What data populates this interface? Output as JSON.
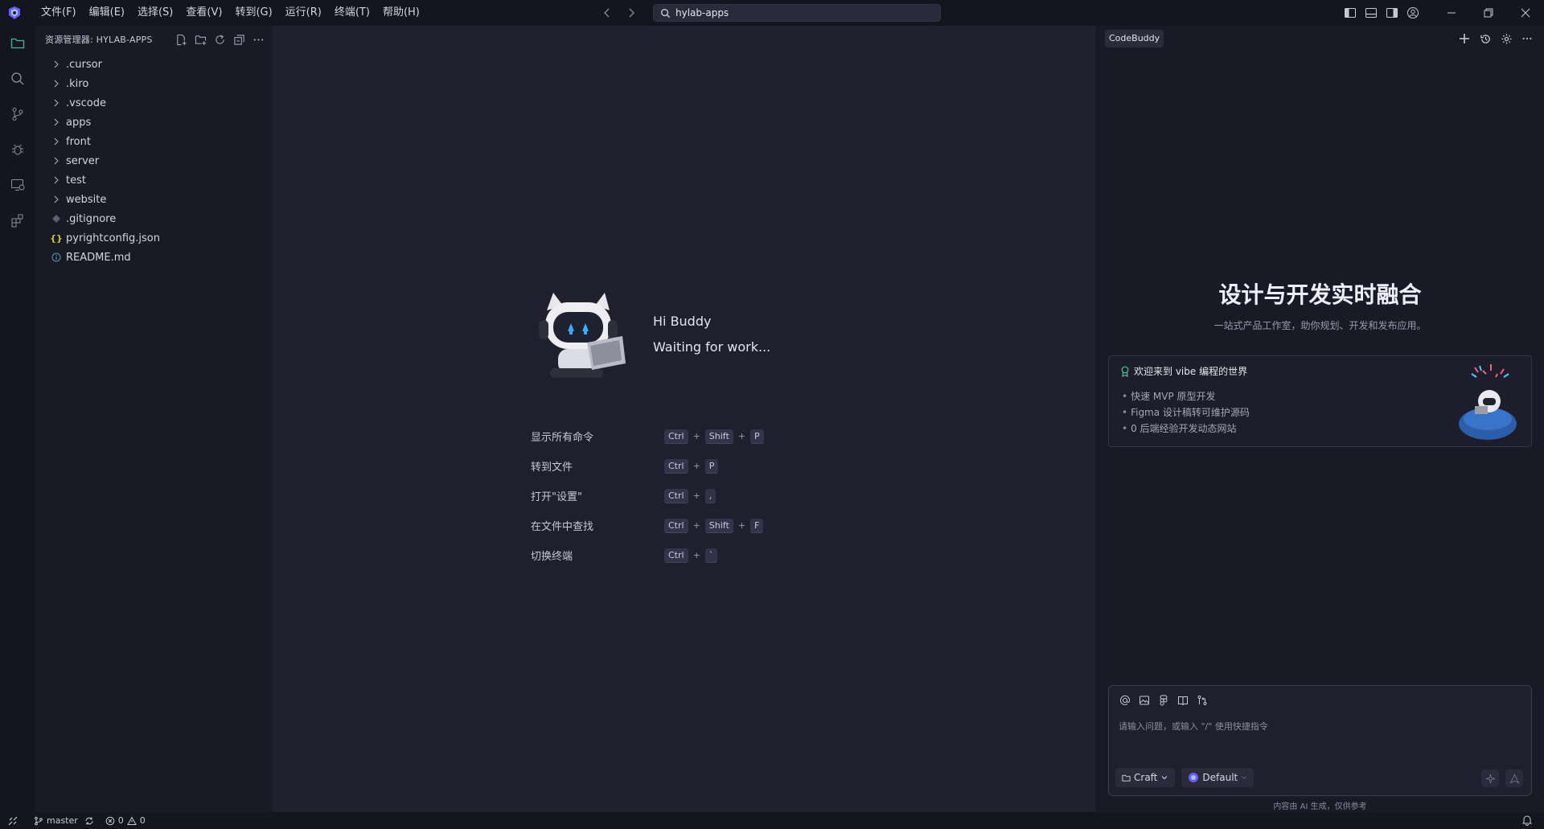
{
  "titlebar": {
    "menus": [
      "文件(F)",
      "编辑(E)",
      "选择(S)",
      "查看(V)",
      "转到(G)",
      "运行(R)",
      "终端(T)",
      "帮助(H)"
    ],
    "search_text": "hylab-apps"
  },
  "sidebar": {
    "title": "资源管理器: HYLAB-APPS",
    "folders": [
      ".cursor",
      ".kiro",
      ".vscode",
      "apps",
      "front",
      "server",
      "test",
      "website"
    ],
    "files": [
      {
        "name": ".gitignore",
        "icon": "git-file-icon"
      },
      {
        "name": "pyrightconfig.json",
        "icon": "json-file-icon"
      },
      {
        "name": "README.md",
        "icon": "info-file-icon"
      }
    ]
  },
  "welcome": {
    "greeting": "Hi Buddy",
    "status": "Waiting for work...",
    "shortcuts": [
      {
        "label": "显示所有命令",
        "keys": [
          "Ctrl",
          "Shift",
          "P"
        ]
      },
      {
        "label": "转到文件",
        "keys": [
          "Ctrl",
          "P"
        ]
      },
      {
        "label": "打开\"设置\"",
        "keys": [
          "Ctrl",
          ","
        ]
      },
      {
        "label": "在文件中查找",
        "keys": [
          "Ctrl",
          "Shift",
          "F"
        ]
      },
      {
        "label": "切换终端",
        "keys": [
          "Ctrl",
          "`"
        ]
      }
    ]
  },
  "panel": {
    "tab": "CodeBuddy",
    "hero_title": "设计与开发实时融合",
    "hero_subtitle": "一站式产品工作室，助你规划、开发和发布应用。",
    "card": {
      "title": "欢迎来到 vibe 编程的世界",
      "items": [
        "快速 MVP 原型开发",
        "Figma 设计稿转可维护源码",
        "0 后端经验开发动态网站"
      ]
    },
    "chat": {
      "placeholder": "请输入问题，或输入 \"/\" 使用快捷指令",
      "mode": "Craft",
      "model": "Default"
    },
    "ai_note": "内容由 AI 生成，仅供参考"
  },
  "statusbar": {
    "branch": "master",
    "errors": "0",
    "warnings": "0"
  }
}
